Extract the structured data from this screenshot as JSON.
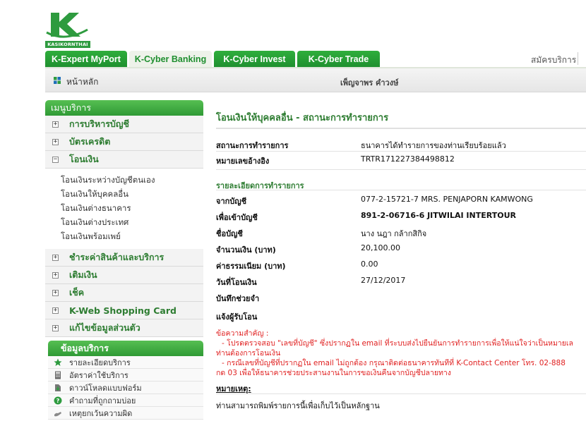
{
  "brand": {
    "logo_text": "KASIKORNTHAI",
    "color": "#2e9b3f"
  },
  "nav": {
    "tabs": [
      {
        "label": "K-Expert MyPort",
        "active": false
      },
      {
        "label": "K-Cyber Banking",
        "active": true
      },
      {
        "label": "K-Cyber Invest",
        "active": false
      },
      {
        "label": "K-Cyber Trade",
        "active": false
      }
    ],
    "register_label": "สมัครบริการ"
  },
  "subbar": {
    "home_label": "หน้าหลัก",
    "user_name": "เพ็ญจาพร คำวงษ์"
  },
  "sidebar": {
    "header": "เมนูบริการ",
    "items": [
      {
        "label": "การบริหารบัญชี",
        "expanded": false
      },
      {
        "label": "บัตรเครดิต",
        "expanded": false
      },
      {
        "label": "โอนเงิน",
        "expanded": true,
        "children": [
          "โอนเงินระหว่างบัญชีตนเอง",
          "โอนเงินให้บุคคลอื่น",
          "โอนเงินต่างธนาคาร",
          "โอนเงินต่างประเทศ",
          "โอนเงินพร้อมเพย์"
        ]
      },
      {
        "label": "ชำระค่าสินค้าและบริการ",
        "expanded": false
      },
      {
        "label": "เติมเงิน",
        "expanded": false
      },
      {
        "label": "เช็ค",
        "expanded": false
      },
      {
        "label": "K-Web Shopping Card",
        "expanded": false
      },
      {
        "label": "แก้ไขข้อมูลส่วนตัว",
        "expanded": false
      }
    ],
    "expand_symbol": "+",
    "collapse_symbol": "−"
  },
  "info_box": {
    "header": "ข้อมูลบริการ",
    "items": [
      {
        "label": "รายละเอียดบริการ",
        "icon": "star-icon"
      },
      {
        "label": "อัตราค่าใช้บริการ",
        "icon": "calculator-icon"
      },
      {
        "label": "ดาวน์โหลดแบบฟอร์ม",
        "icon": "download-icon"
      },
      {
        "label": "คำถามที่ถูกถามบ่อย",
        "icon": "question-icon"
      },
      {
        "label": "เหตุยกเว้นความผิด",
        "icon": "hand-icon"
      }
    ]
  },
  "main": {
    "title": "โอนเงินให้บุคคลอื่น - สถานะการทำรายการ",
    "status": {
      "label": "สถานะการทำรายการ",
      "value": "ธนาคารได้ทำรายการของท่านเรียบร้อยแล้ว"
    },
    "reference": {
      "label": "หมายเลขอ้างอิง",
      "value": "TRTR171227384498812"
    },
    "details_title": "รายละเอียดการทำรายการ",
    "details": [
      {
        "label": "จากบัญชี",
        "value": "077-2-15721-7 MRS. PENJAPORN KAMWONG",
        "bold": false
      },
      {
        "label": "เพื่อเข้าบัญชี",
        "value": "891-2-06716-6 JITWILAI INTERTOUR",
        "bold": true
      },
      {
        "label": "ชื่อบัญชี",
        "value": "นาง นฎา กล้ากสิกิจ",
        "bold": false
      },
      {
        "label": "จำนวนเงิน (บาท)",
        "value": "20,100.00",
        "bold": false
      },
      {
        "label": "ค่าธรรมเนียม (บาท)",
        "value": "0.00",
        "bold": false
      },
      {
        "label": "วันที่โอนเงิน",
        "value": "27/12/2017",
        "bold": false
      },
      {
        "label": "บันทึกช่วยจำ",
        "value": "",
        "bold": false
      },
      {
        "label": "แจ้งผู้รับโอน",
        "value": "",
        "bold": false
      }
    ],
    "important": {
      "title": "ข้อความสำคัญ :",
      "line1": "- โปรดตรวจสอบ \"เลขที่บัญชี\" ซึ่งปรากฏใน email ที่ระบบส่งไปยืนยันการทำรายการเพื่อให้แน่ใจว่าเป็นหมายเล",
      "line1b": "ท่านต้องการโอนเงิน",
      "line2": "- กรณีเลขที่บัญชีที่ปรากฏใน email ไม่ถูกต้อง กรุณาติดต่อธนาคารทันทีที่ K-Contact Center โทร. 02-888",
      "line2b": "กด 03 เพื่อให้ธนาคารช่วยประสานงานในการขอเงินคืนจากบัญชีปลายทาง",
      "color": "#e02020"
    },
    "remark_title": "หมายเหตุ:",
    "print_note": "ท่านสามารถพิมพ์รายการนี้เพื่อเก็บไว้เป็นหลักฐาน"
  }
}
